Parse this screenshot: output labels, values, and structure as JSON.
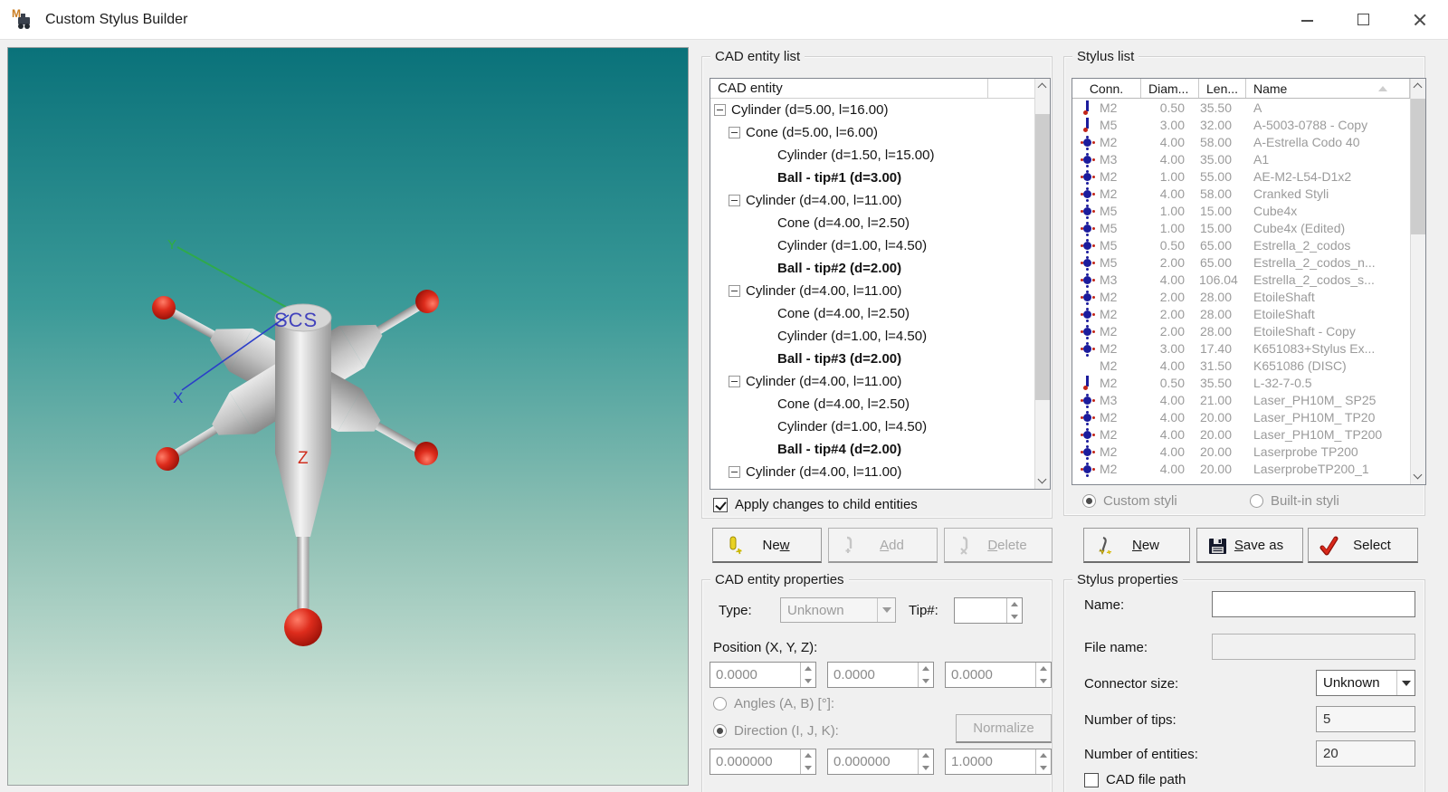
{
  "window": {
    "title": "Custom Stylus Builder"
  },
  "viewport": {
    "axis_labels": {
      "scs": "SCS",
      "x": "X",
      "y": "Y",
      "z": "Z"
    },
    "colors": {
      "bg_top": "#0a727a",
      "bg_mid": "#4da5a0",
      "bg_bottom": "#d7e8de",
      "ball_red": "#cf1d12",
      "x_axis_blue": "#2b3ec9",
      "y_axis_green": "#2fae3f",
      "scs_label_blue": "#2a2ab8",
      "z_label_red": "#d03020",
      "metal_gray": "#c9c9c9"
    }
  },
  "cad_entity_list": {
    "group_label": "CAD entity list",
    "column_header": "CAD entity",
    "tree": [
      {
        "cls": "lvl0 exp",
        "label": "Cylinder (d=5.00, l=16.00)"
      },
      {
        "cls": "lvl1 exp",
        "label": "Cone (d=5.00, l=6.00)"
      },
      {
        "cls": "lvl2",
        "label": "Cylinder (d=1.50, l=15.00)"
      },
      {
        "cls": "lvl2 bold",
        "label": "Ball - tip#1 (d=3.00)"
      },
      {
        "cls": "lvl1 exp",
        "label": "Cylinder (d=4.00, l=11.00)"
      },
      {
        "cls": "lvl2",
        "label": "Cone (d=4.00, l=2.50)"
      },
      {
        "cls": "lvl2",
        "label": "Cylinder (d=1.00, l=4.50)"
      },
      {
        "cls": "lvl2 bold",
        "label": "Ball - tip#2 (d=2.00)"
      },
      {
        "cls": "lvl1 exp",
        "label": "Cylinder (d=4.00, l=11.00)"
      },
      {
        "cls": "lvl2",
        "label": "Cone (d=4.00, l=2.50)"
      },
      {
        "cls": "lvl2",
        "label": "Cylinder (d=1.00, l=4.50)"
      },
      {
        "cls": "lvl2 bold",
        "label": "Ball - tip#3 (d=2.00)"
      },
      {
        "cls": "lvl1 exp",
        "label": "Cylinder (d=4.00, l=11.00)"
      },
      {
        "cls": "lvl2",
        "label": "Cone (d=4.00, l=2.50)"
      },
      {
        "cls": "lvl2",
        "label": "Cylinder (d=1.00, l=4.50)"
      },
      {
        "cls": "lvl2 bold",
        "label": "Ball - tip#4 (d=2.00)"
      },
      {
        "cls": "lvl1 exp",
        "label": "Cylinder (d=4.00, l=11.00)"
      }
    ],
    "apply_checkbox": {
      "label": "Apply changes to child entities",
      "checked": true
    },
    "buttons": {
      "new": {
        "label": "New",
        "u": 2
      },
      "add": {
        "label": "Add",
        "u": 0
      },
      "delete": {
        "label": "Delete",
        "u": 0
      }
    }
  },
  "cad_entity_properties": {
    "group_label": "CAD entity properties",
    "type_label": "Type:",
    "type_value": "Unknown",
    "tip_label": "Tip#:",
    "tip_value": "",
    "position_label": "Position (X, Y, Z):",
    "position_values": [
      "0.0000",
      "0.0000",
      "0.0000"
    ],
    "angles_label": "Angles (A, B) [°]:",
    "direction_label": "Direction (I, J, K):",
    "normalize_label": "Normalize",
    "direction_values": [
      "0.000000",
      "0.000000",
      "1.0000"
    ]
  },
  "stylus_list": {
    "group_label": "Stylus list",
    "columns": [
      "Conn.",
      "Diam...",
      "Len...",
      "Name"
    ],
    "rows": [
      {
        "icon": "straight",
        "conn": "M2",
        "diam": "0.50",
        "len": "35.50",
        "name": "A"
      },
      {
        "icon": "straight",
        "conn": "M5",
        "diam": "3.00",
        "len": "32.00",
        "name": "A-5003-0788 - Copy"
      },
      {
        "icon": "star",
        "conn": "M2",
        "diam": "4.00",
        "len": "58.00",
        "name": "A-Estrella Codo 40"
      },
      {
        "icon": "star",
        "conn": "M3",
        "diam": "4.00",
        "len": "35.00",
        "name": "A1"
      },
      {
        "icon": "star",
        "conn": "M2",
        "diam": "1.00",
        "len": "55.00",
        "name": "AE-M2-L54-D1x2"
      },
      {
        "icon": "star",
        "conn": "M2",
        "diam": "4.00",
        "len": "58.00",
        "name": "Cranked Styli"
      },
      {
        "icon": "star",
        "conn": "M5",
        "diam": "1.00",
        "len": "15.00",
        "name": "Cube4x"
      },
      {
        "icon": "star",
        "conn": "M5",
        "diam": "1.00",
        "len": "15.00",
        "name": "Cube4x (Edited)"
      },
      {
        "icon": "star",
        "conn": "M5",
        "diam": "0.50",
        "len": "65.00",
        "name": "Estrella_2_codos"
      },
      {
        "icon": "star",
        "conn": "M5",
        "diam": "2.00",
        "len": "65.00",
        "name": "Estrella_2_codos_n..."
      },
      {
        "icon": "star",
        "conn": "M3",
        "diam": "4.00",
        "len": "106.04",
        "name": "Estrella_2_codos_s..."
      },
      {
        "icon": "star",
        "conn": "M2",
        "diam": "2.00",
        "len": "28.00",
        "name": "EtoileShaft"
      },
      {
        "icon": "star",
        "conn": "M2",
        "diam": "2.00",
        "len": "28.00",
        "name": "EtoileShaft"
      },
      {
        "icon": "star",
        "conn": "M2",
        "diam": "2.00",
        "len": "28.00",
        "name": "EtoileShaft - Copy"
      },
      {
        "icon": "star",
        "conn": "M2",
        "diam": "3.00",
        "len": "17.40",
        "name": "K651083+Stylus Ex..."
      },
      {
        "icon": "none",
        "conn": "M2",
        "diam": "4.00",
        "len": "31.50",
        "name": "K651086 (DISC)"
      },
      {
        "icon": "straight",
        "conn": "M2",
        "diam": "0.50",
        "len": "35.50",
        "name": "L-32-7-0.5"
      },
      {
        "icon": "star",
        "conn": "M3",
        "diam": "4.00",
        "len": "21.00",
        "name": "Laser_PH10M_ SP25"
      },
      {
        "icon": "star",
        "conn": "M2",
        "diam": "4.00",
        "len": "20.00",
        "name": "Laser_PH10M_ TP20"
      },
      {
        "icon": "star",
        "conn": "M2",
        "diam": "4.00",
        "len": "20.00",
        "name": "Laser_PH10M_ TP200"
      },
      {
        "icon": "star",
        "conn": "M2",
        "diam": "4.00",
        "len": "20.00",
        "name": "Laserprobe TP200"
      },
      {
        "icon": "star",
        "conn": "M2",
        "diam": "4.00",
        "len": "20.00",
        "name": "LaserprobeTP200_1"
      }
    ],
    "custom_radio": {
      "label": "Custom styli",
      "selected": true
    },
    "builtin_radio": {
      "label": "Built-in styli",
      "selected": false
    },
    "buttons": {
      "new": {
        "label": "New",
        "u": 0
      },
      "save_as": {
        "label": "Save as",
        "u": 0
      },
      "select": {
        "label": "Select"
      }
    }
  },
  "stylus_properties": {
    "group_label": "Stylus properties",
    "name_label": "Name:",
    "name_value": "",
    "file_name_label": "File name:",
    "file_name_value": "",
    "connector_size_label": "Connector size:",
    "connector_size_value": "Unknown",
    "tips_label": "Number of tips:",
    "tips_value": "5",
    "entities_label": "Number of entities:",
    "entities_value": "20",
    "cad_file_path": {
      "label": "CAD file path",
      "checked": false
    }
  }
}
